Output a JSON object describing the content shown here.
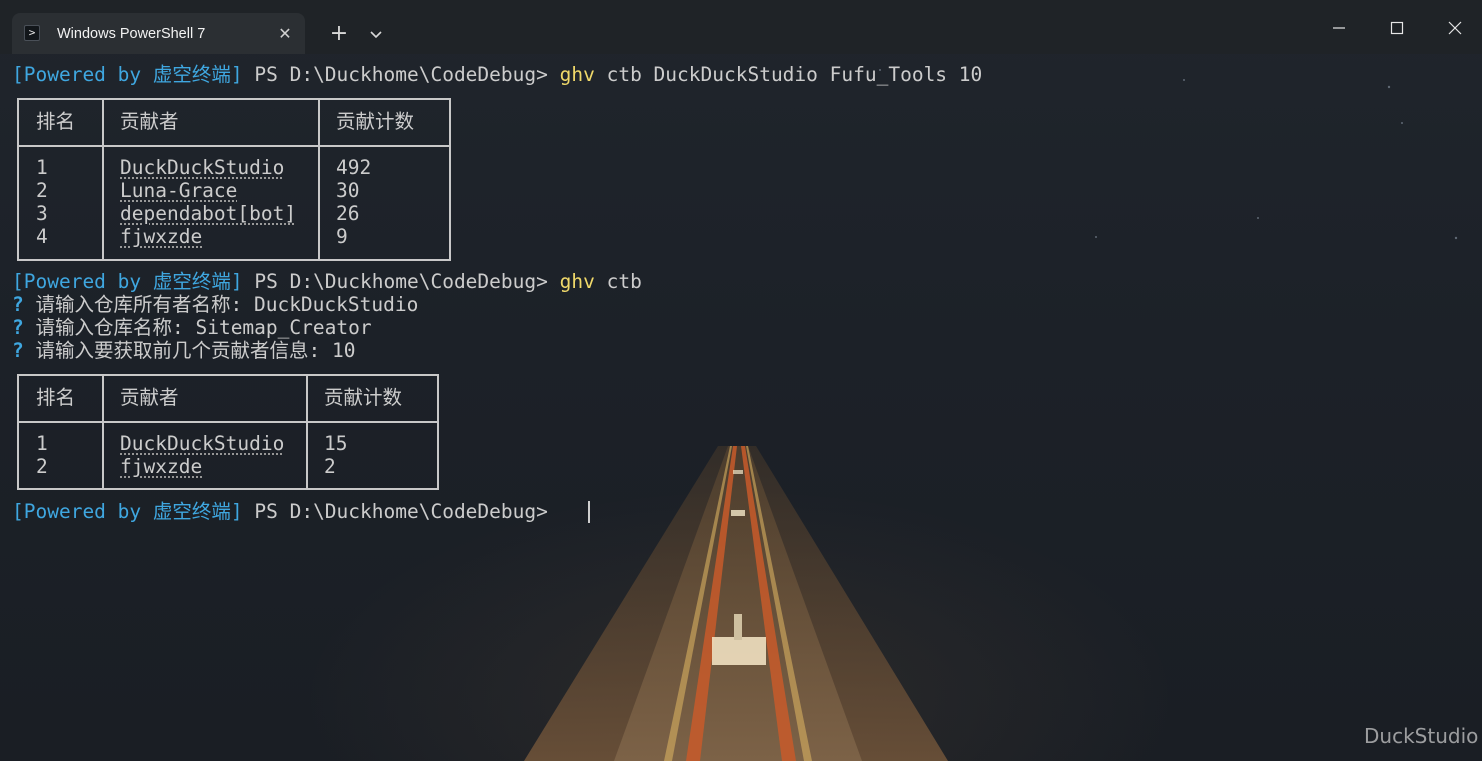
{
  "window": {
    "tab_title": "Windows PowerShell 7",
    "tab_icon": "powershell-icon",
    "new_tab_icon": "plus-icon",
    "dropdown_icon": "chevron-down-icon",
    "controls": [
      "minimize-icon",
      "maximize-icon",
      "close-icon"
    ]
  },
  "prompt": {
    "powered": "[Powered by 虚空终端]",
    "ps": " PS D:\\Duckhome\\CodeDebug> "
  },
  "session1": {
    "command": "ghv ctb DuckDuckStudio Fufu_Tools 10",
    "table": {
      "headers": [
        "排名",
        "贡献者",
        "贡献计数"
      ],
      "rows": [
        [
          "1",
          "DuckDuckStudio",
          "492"
        ],
        [
          "2",
          "Luna-Grace",
          "30"
        ],
        [
          "3",
          "dependabot[bot]",
          "26"
        ],
        [
          "4",
          "fjwxzde",
          "9"
        ]
      ]
    }
  },
  "session2": {
    "command": "ghv ctb",
    "questions": [
      {
        "mark": "?",
        "text": " 请输入仓库所有者名称: DuckDuckStudio"
      },
      {
        "mark": "?",
        "text": " 请输入仓库名称: Sitemap_Creator"
      },
      {
        "mark": "?",
        "text": " 请输入要获取前几个贡献者信息: 10"
      }
    ],
    "table": {
      "headers": [
        "排名",
        "贡献者",
        "贡献计数"
      ],
      "rows": [
        [
          "1",
          "DuckDuckStudio",
          "15"
        ],
        [
          "2",
          "fjwxzde",
          "2"
        ]
      ]
    }
  },
  "watermark": "DuckStudio",
  "colors": {
    "prompt_blue": "#3fa7e0",
    "command_yellow": "#f0d96a",
    "text": "#cccccc"
  }
}
